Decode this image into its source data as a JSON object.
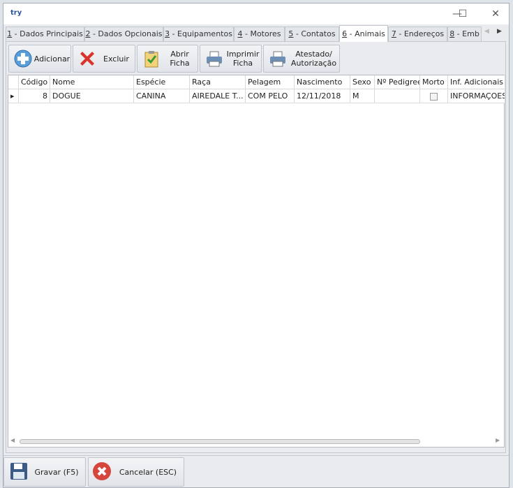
{
  "window": {
    "title": "try",
    "minimize": "—",
    "maximize": "☐",
    "close": "✕"
  },
  "tabs": [
    {
      "num": "1",
      "label": " - Dados Principais"
    },
    {
      "num": "2",
      "label": " - Dados Opcionais"
    },
    {
      "num": "3",
      "label": " - Equipamentos"
    },
    {
      "num": "4",
      "label": " - Motores"
    },
    {
      "num": "5",
      "label": " - Contatos"
    },
    {
      "num": "6",
      "label": " - Animais",
      "active": true
    },
    {
      "num": "7",
      "label": " - Endereços"
    },
    {
      "num": "8",
      "label": " - Emb"
    }
  ],
  "toolbar": {
    "add": "Adicionar",
    "delete": "Excluir",
    "open": "Abrir Ficha",
    "print": "Imprimir Ficha",
    "certificate": "Atestado/ Autorização"
  },
  "grid": {
    "columns": [
      "Código",
      "Nome",
      "Espécie",
      "Raça",
      "Pelagem",
      "Nascimento",
      "Sexo",
      "Nº Pedigree",
      "Morto",
      "Inf. Adicionais"
    ],
    "rows": [
      {
        "codigo": "8",
        "nome": "DOGUE",
        "especie": "CANINA",
        "raca": "AIREDALE T...",
        "pelagem": "COM PELO",
        "nascimento": "12/11/2018",
        "sexo": "M",
        "pedigree": "",
        "morto": false,
        "inf": "INFORMAÇOES"
      }
    ]
  },
  "footer": {
    "save": "Gravar (F5)",
    "cancel": "Cancelar (ESC)"
  }
}
